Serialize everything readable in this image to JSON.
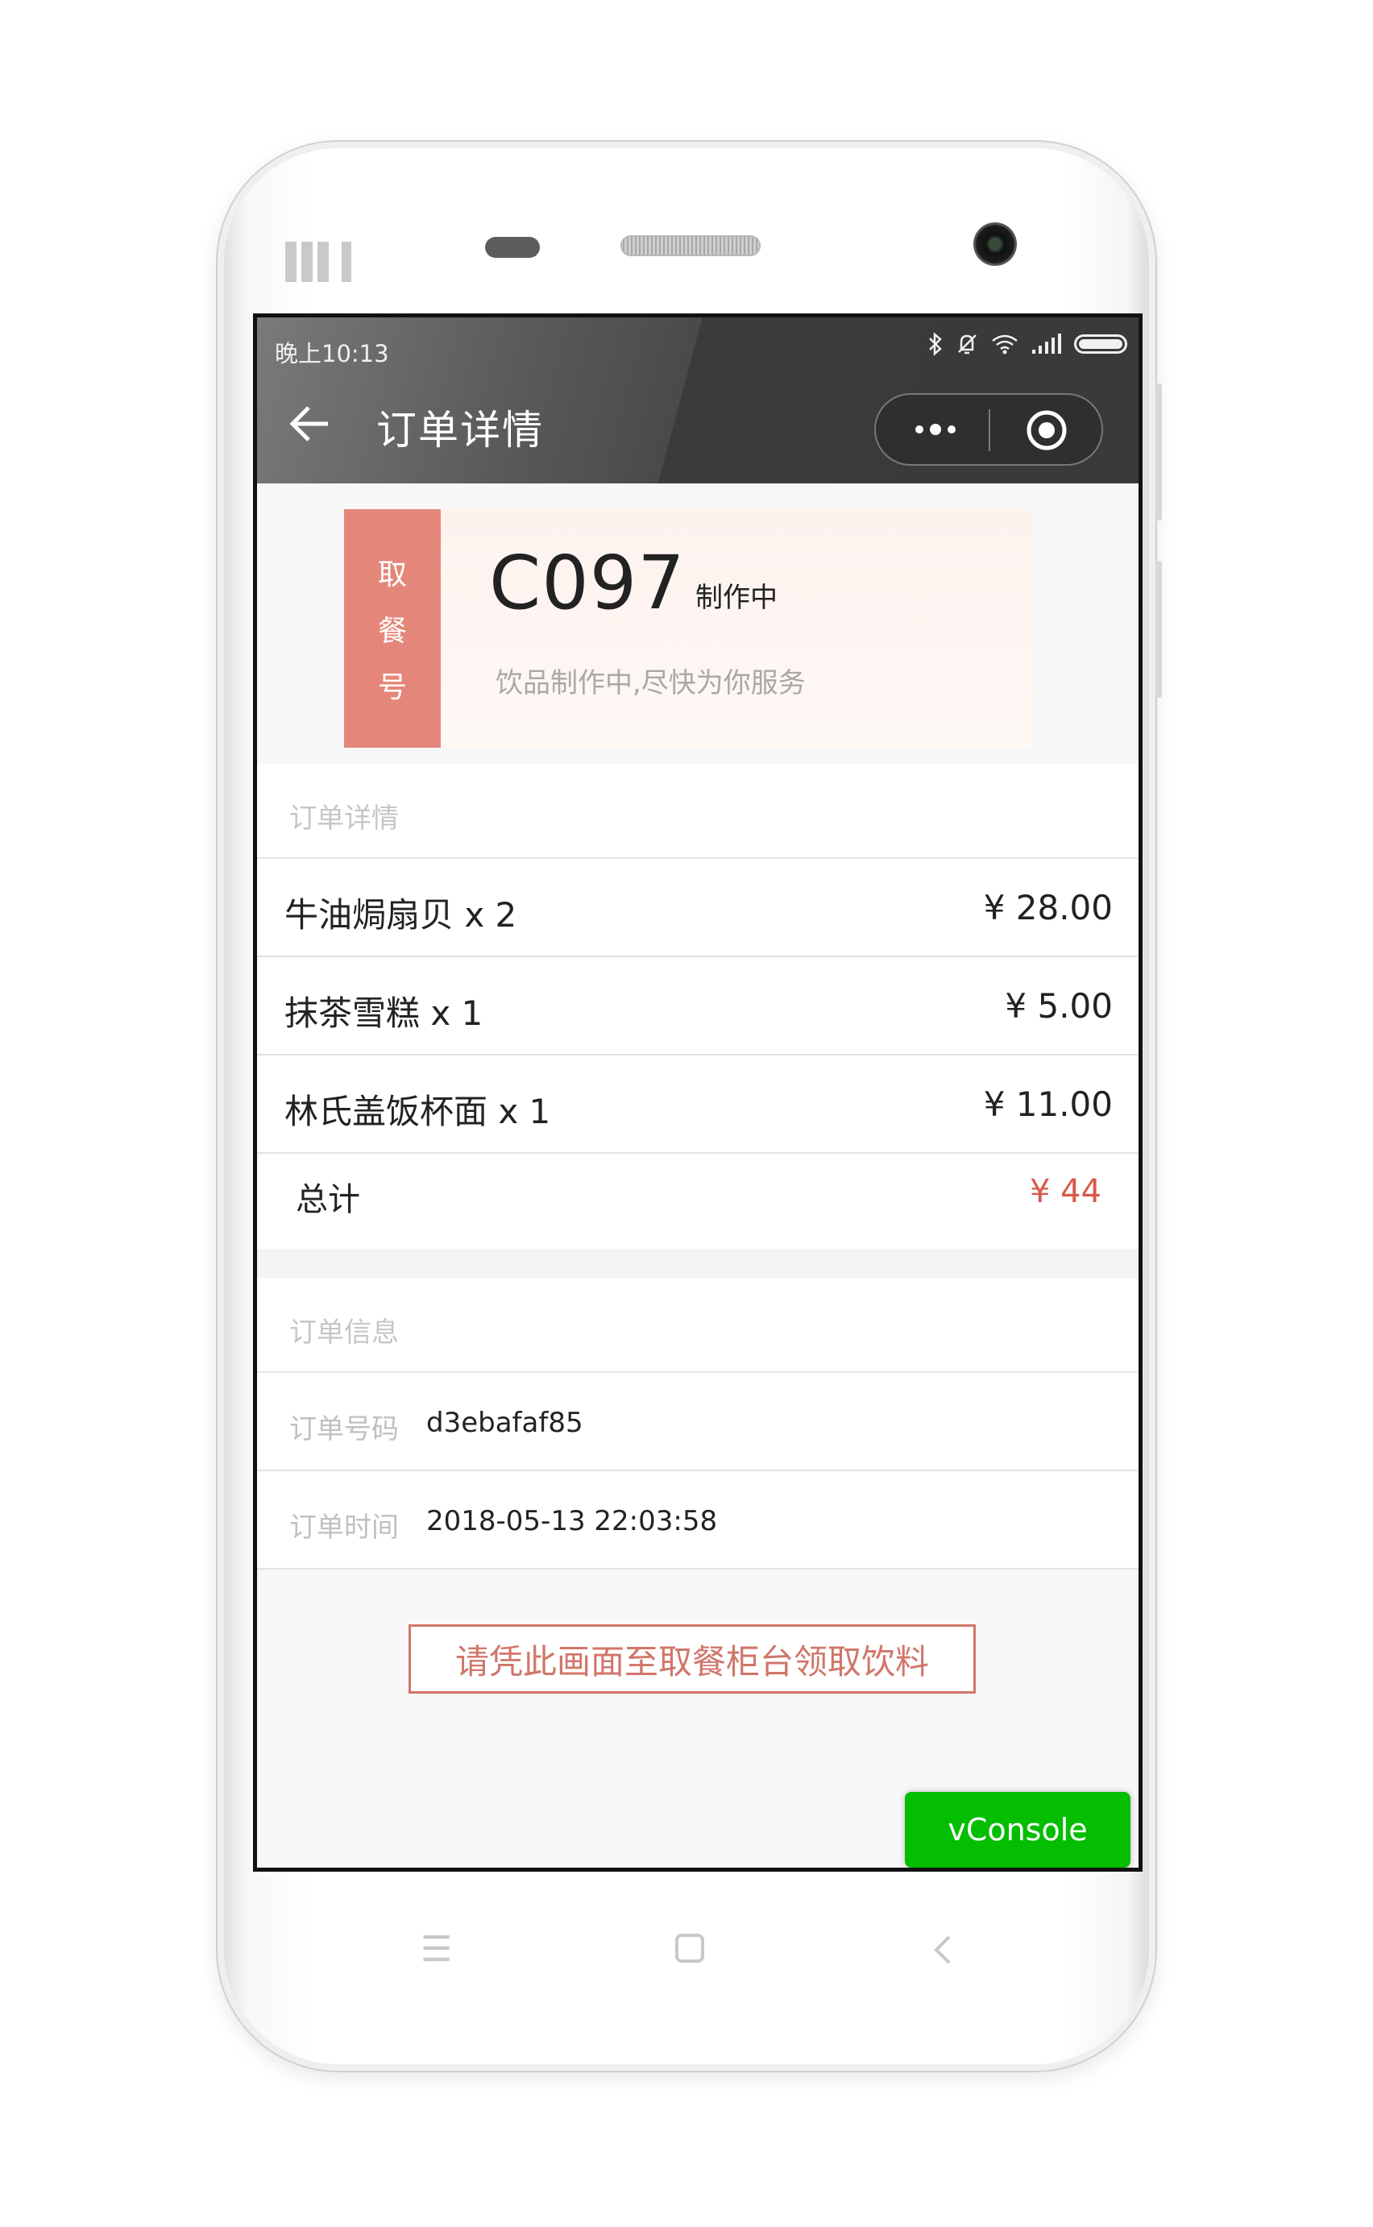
{
  "status_bar": {
    "time": "晚上10:13",
    "icons": [
      "bluetooth-icon",
      "bell-muted-icon",
      "wifi-icon",
      "signal-icon",
      "battery-icon"
    ]
  },
  "nav": {
    "title": "订单详情",
    "back_icon": "back-arrow-icon",
    "more_icon": "more-dots-icon",
    "close_icon": "target-circle-icon"
  },
  "pickup": {
    "tab_chars": [
      "取",
      "餐",
      "号"
    ],
    "number": "C097",
    "status": "制作中",
    "tip": "饮品制作中,尽快为你服务"
  },
  "order_details": {
    "header": "订单详情",
    "items": [
      {
        "name": "牛油焗扇贝 x 2",
        "price": "¥ 28.00"
      },
      {
        "name": "抹茶雪糕 x 1",
        "price": "¥ 5.00"
      },
      {
        "name": "林氏盖饭杯面 x 1",
        "price": "¥ 11.00"
      }
    ],
    "total_label": "总计",
    "total_value": "¥ 44"
  },
  "order_info": {
    "header": "订单信息",
    "number_label": "订单号码",
    "number_value": "d3ebafaf85",
    "time_label": "订单时间",
    "time_value": "2018-05-13 22:03:58"
  },
  "notice": "请凭此画面至取餐柜台领取饮料",
  "vconsole": "vConsole",
  "colors": {
    "accent": "#e4877a",
    "price_highlight": "#d85a4c",
    "vconsole_green": "#04be02",
    "topbar": "#3a3a3a"
  }
}
